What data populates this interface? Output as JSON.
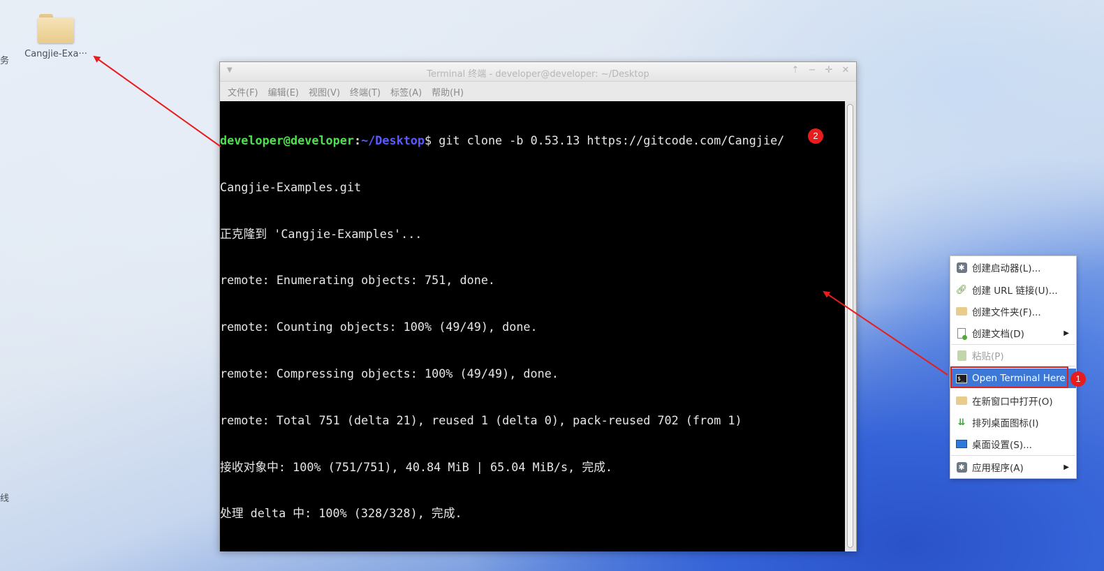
{
  "desktop": {
    "icons": [
      {
        "label": "Cangjie-Exa···",
        "icon": "folder-icon"
      }
    ],
    "edge_labels": [
      "务",
      "线"
    ]
  },
  "terminal": {
    "title": "Terminal 终端 - developer@developer: ~/Desktop",
    "menu": [
      "文件(F)",
      "编辑(E)",
      "视图(V)",
      "终端(T)",
      "标签(A)",
      "帮助(H)"
    ],
    "prompt_user": "developer@developer",
    "prompt_path": "~/Desktop",
    "command": "git clone -b 0.53.13 https://gitcode.com/Cangjie/",
    "output": [
      "Cangjie-Examples.git",
      "正克隆到 'Cangjie-Examples'...",
      "remote: Enumerating objects: 751, done.",
      "remote: Counting objects: 100% (49/49), done.",
      "remote: Compressing objects: 100% (49/49), done.",
      "remote: Total 751 (delta 21), reused 1 (delta 0), pack-reused 702 (from 1)",
      "接收对象中: 100% (751/751), 40.84 MiB | 65.04 MiB/s, 完成.",
      "处理 delta 中: 100% (328/328), 完成."
    ]
  },
  "context_menu": {
    "items": [
      {
        "label": "创建启动器(L)...",
        "icon": "gear-icon"
      },
      {
        "label": "创建 URL 链接(U)...",
        "icon": "link-icon"
      },
      {
        "label": "创建文件夹(F)...",
        "icon": "folder-add-icon"
      },
      {
        "label": "创建文档(D)",
        "icon": "document-add-icon",
        "submenu": true
      },
      {
        "label": "粘贴(P)",
        "icon": "paste-icon",
        "disabled": true
      },
      {
        "label": "Open Terminal Here",
        "icon": "terminal-icon",
        "highlighted": true
      },
      {
        "label": "在新窗口中打开(O)",
        "icon": "folder-icon"
      },
      {
        "label": "排列桌面图标(I)",
        "icon": "sort-icon"
      },
      {
        "label": "桌面设置(S)...",
        "icon": "monitor-icon"
      },
      {
        "label": "应用程序(A)",
        "icon": "gear-icon",
        "submenu": true
      }
    ]
  },
  "annotations": {
    "badge_1": "1",
    "badge_2": "2",
    "color": "#e81c1c"
  },
  "colors": {
    "prompt_user": "#4ee04e",
    "prompt_path": "#5a5aff",
    "menu_highlight": "#3b78d8"
  }
}
